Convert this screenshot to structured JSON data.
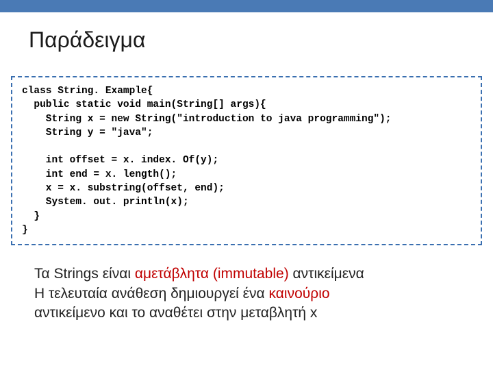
{
  "title": "Παράδειγμα",
  "code": {
    "l1": "class String. Example{",
    "l2": "  public static void main(String[] args){",
    "l3a": "    String x = new String(",
    "l3b": "\"introduction to java programming\"",
    "l3c": ");",
    "l4a": "    String y = ",
    "l4b": "\"java\"",
    "l4c": ";",
    "blank1": "",
    "l5": "    int offset = x. index. Of(y);",
    "l6": "    int end = x. length();",
    "l7": "    x = x. substring(offset, end);",
    "l8": "    System. out. println(x);",
    "l9": "  }",
    "l10": "}"
  },
  "explain": {
    "p1a": "Τα Strings είναι ",
    "p1b": "αμετάβλητα (immutable)",
    "p1c": " αντικείμενα",
    "p2a": "Η τελευταία ανάθεση δημιουργεί ένα ",
    "p2b": "καινούριο",
    "p3": "αντικείμενο και το αναθέτει στην μεταβλητή x"
  }
}
